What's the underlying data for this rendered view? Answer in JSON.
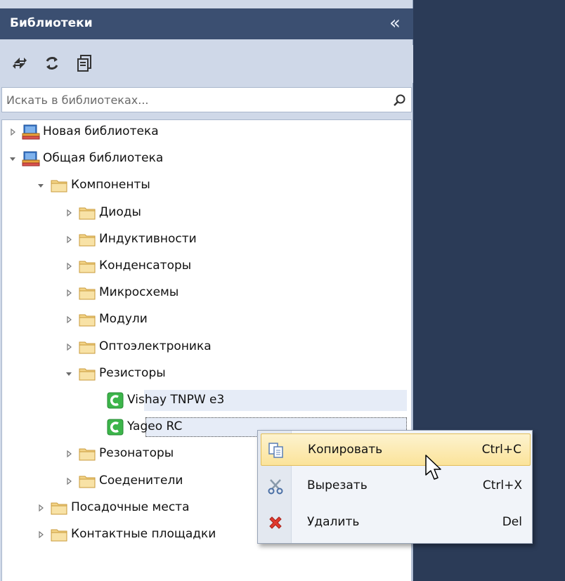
{
  "panel": {
    "title": "Библиотеки",
    "collapse_glyph": "«"
  },
  "toolbar": {
    "icons": [
      "swap-arrows-icon",
      "refresh-icon",
      "copy-stack-icon"
    ]
  },
  "search": {
    "placeholder": "Искать в библиотеках...",
    "value": ""
  },
  "tree": {
    "items": [
      {
        "label": "Новая библиотека",
        "icon": "library-icon",
        "expanded": false
      },
      {
        "label": "Общая библиотека",
        "icon": "library-icon",
        "expanded": true
      },
      {
        "label": "Компоненты",
        "icon": "folder-icon",
        "expanded": true
      },
      {
        "label": "Диоды",
        "icon": "folder-icon",
        "expanded": false
      },
      {
        "label": "Индуктивности",
        "icon": "folder-icon",
        "expanded": false
      },
      {
        "label": "Конденсаторы",
        "icon": "folder-icon",
        "expanded": false
      },
      {
        "label": "Микросхемы",
        "icon": "folder-icon",
        "expanded": false
      },
      {
        "label": "Модули",
        "icon": "folder-icon",
        "expanded": false
      },
      {
        "label": "Оптоэлектроника",
        "icon": "folder-icon",
        "expanded": false
      },
      {
        "label": "Резисторы",
        "icon": "folder-icon",
        "expanded": true
      },
      {
        "label": "Vishay TNPW e3",
        "icon": "component-icon"
      },
      {
        "label": "Yageo RC",
        "icon": "component-icon"
      },
      {
        "label": "Резонаторы",
        "icon": "folder-icon",
        "expanded": false
      },
      {
        "label": "Соеденители",
        "icon": "folder-icon",
        "expanded": false
      },
      {
        "label": "Посадочные места",
        "icon": "folder-icon",
        "expanded": false
      },
      {
        "label": "Контактные площадки",
        "icon": "folder-icon",
        "expanded": false
      }
    ]
  },
  "context_menu": {
    "items": [
      {
        "label": "Копировать",
        "shortcut": "Ctrl+C",
        "icon": "copy-icon"
      },
      {
        "label": "Вырезать",
        "shortcut": "Ctrl+X",
        "icon": "scissors-icon"
      },
      {
        "label": "Удалить",
        "shortcut": "Del",
        "icon": "delete-x-icon"
      }
    ]
  },
  "colors": {
    "background": "#2b3b57",
    "header": "#3b4f71",
    "panel": "#cfd8e8",
    "menu_hover": "#fbe39a",
    "component_green": "#3cb54a"
  }
}
